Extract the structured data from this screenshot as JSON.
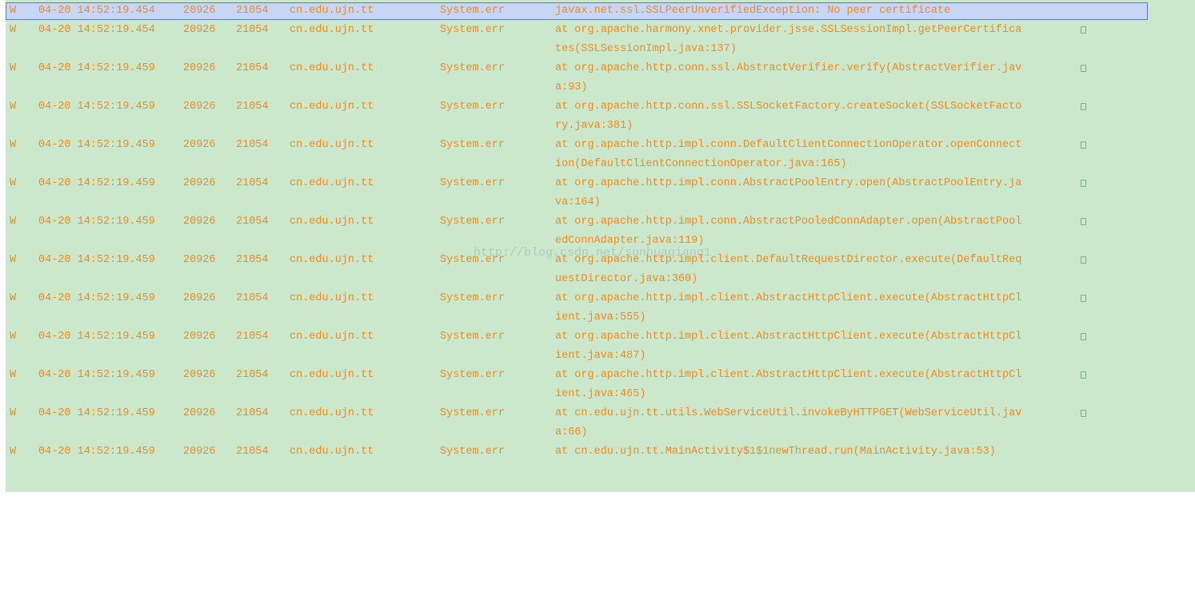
{
  "colors": {
    "background": "#cbe8cd",
    "log_text": "#f28a1c",
    "selection_bg": "#c7d6f4",
    "selection_border": "#5b7bb8"
  },
  "watermark": "http://blog.csdn.net/sunhuaqiang1",
  "rows": [
    {
      "level": "W",
      "time": "04-20 14:52:19.454",
      "pid": "20926",
      "tid": "21054",
      "app": "cn.edu.ujn.tt",
      "tag": "System.err",
      "text": "javax.net.ssl.SSLPeerUnverifiedException: No peer certificate",
      "cont": ""
    },
    {
      "level": "W",
      "time": "04-20 14:52:19.454",
      "pid": "20926",
      "tid": "21054",
      "app": "cn.edu.ujn.tt",
      "tag": "System.err",
      "text": "at org.apache.harmony.xnet.provider.jsse.SSLSessionImpl.getPeerCertifica",
      "cont": "tes(SSLSessionImpl.java:137)"
    },
    {
      "level": "W",
      "time": "04-20 14:52:19.459",
      "pid": "20926",
      "tid": "21054",
      "app": "cn.edu.ujn.tt",
      "tag": "System.err",
      "text": "at org.apache.http.conn.ssl.AbstractVerifier.verify(AbstractVerifier.jav",
      "cont": "a:93)"
    },
    {
      "level": "W",
      "time": "04-20 14:52:19.459",
      "pid": "20926",
      "tid": "21054",
      "app": "cn.edu.ujn.tt",
      "tag": "System.err",
      "text": "at org.apache.http.conn.ssl.SSLSocketFactory.createSocket(SSLSocketFacto",
      "cont": "ry.java:381)"
    },
    {
      "level": "W",
      "time": "04-20 14:52:19.459",
      "pid": "20926",
      "tid": "21054",
      "app": "cn.edu.ujn.tt",
      "tag": "System.err",
      "text": "at org.apache.http.impl.conn.DefaultClientConnectionOperator.openConnect",
      "cont": "ion(DefaultClientConnectionOperator.java:165)"
    },
    {
      "level": "W",
      "time": "04-20 14:52:19.459",
      "pid": "20926",
      "tid": "21054",
      "app": "cn.edu.ujn.tt",
      "tag": "System.err",
      "text": "at org.apache.http.impl.conn.AbstractPoolEntry.open(AbstractPoolEntry.ja",
      "cont": "va:164)"
    },
    {
      "level": "W",
      "time": "04-20 14:52:19.459",
      "pid": "20926",
      "tid": "21054",
      "app": "cn.edu.ujn.tt",
      "tag": "System.err",
      "text": "at org.apache.http.impl.conn.AbstractPooledConnAdapter.open(AbstractPool",
      "cont": "edConnAdapter.java:119)"
    },
    {
      "level": "W",
      "time": "04-20 14:52:19.459",
      "pid": "20926",
      "tid": "21054",
      "app": "cn.edu.ujn.tt",
      "tag": "System.err",
      "text": "at org.apache.http.impl.client.DefaultRequestDirector.execute(DefaultReq",
      "cont": "uestDirector.java:360)"
    },
    {
      "level": "W",
      "time": "04-20 14:52:19.459",
      "pid": "20926",
      "tid": "21054",
      "app": "cn.edu.ujn.tt",
      "tag": "System.err",
      "text": "at org.apache.http.impl.client.AbstractHttpClient.execute(AbstractHttpCl",
      "cont": "ient.java:555)"
    },
    {
      "level": "W",
      "time": "04-20 14:52:19.459",
      "pid": "20926",
      "tid": "21054",
      "app": "cn.edu.ujn.tt",
      "tag": "System.err",
      "text": "at org.apache.http.impl.client.AbstractHttpClient.execute(AbstractHttpCl",
      "cont": "ient.java:487)"
    },
    {
      "level": "W",
      "time": "04-20 14:52:19.459",
      "pid": "20926",
      "tid": "21054",
      "app": "cn.edu.ujn.tt",
      "tag": "System.err",
      "text": "at org.apache.http.impl.client.AbstractHttpClient.execute(AbstractHttpCl",
      "cont": "ient.java:465)"
    },
    {
      "level": "W",
      "time": "04-20 14:52:19.459",
      "pid": "20926",
      "tid": "21054",
      "app": "cn.edu.ujn.tt",
      "tag": "System.err",
      "text": "at cn.edu.ujn.tt.utils.WebServiceUtil.invokeByHTTPGET(WebServiceUtil.jav",
      "cont": "a:66)"
    },
    {
      "level": "W",
      "time": "04-20 14:52:19.459",
      "pid": "20926",
      "tid": "21054",
      "app": "cn.edu.ujn.tt",
      "tag": "System.err",
      "text": "at cn.edu.ujn.tt.MainActivity$1$1newThread.run(MainActivity.java:53)",
      "cont": ""
    }
  ]
}
